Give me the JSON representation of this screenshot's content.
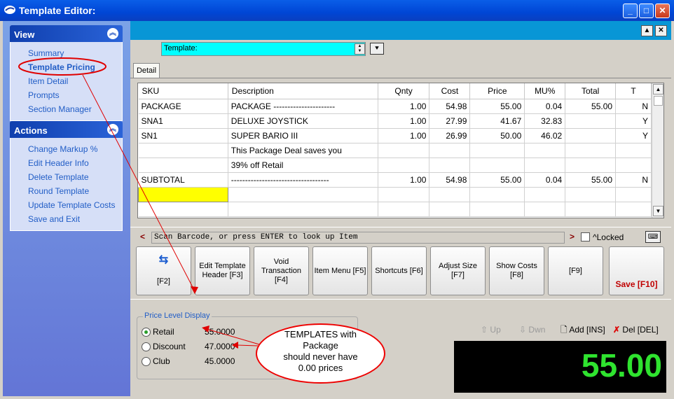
{
  "window": {
    "title": "Template Editor:"
  },
  "view_panel": {
    "title": "View",
    "items": [
      "Summary",
      "Template Pricing",
      "Item Detail",
      "Prompts",
      "Section Manager"
    ]
  },
  "actions_panel": {
    "title": "Actions",
    "items": [
      "Change Markup %",
      "Edit Header Info",
      "Delete Template",
      "Round Template",
      "Update Template Costs",
      "Save and Exit"
    ]
  },
  "template": {
    "label": "Template:"
  },
  "tab": {
    "detail": "Detail"
  },
  "grid": {
    "columns": [
      "SKU",
      "Description",
      "Qnty",
      "Cost",
      "Price",
      "MU%",
      "Total",
      "T"
    ],
    "rows": [
      [
        "PACKAGE",
        "PACKAGE ----------------------",
        "1.00",
        "54.98",
        "55.00",
        "0.04",
        "55.00",
        "N"
      ],
      [
        "SNA1",
        "DELUXE JOYSTICK",
        "1.00",
        "27.99",
        "41.67",
        "32.83",
        "",
        "Y"
      ],
      [
        "SN1",
        "SUPER BARIO III",
        "1.00",
        "26.99",
        "50.00",
        "46.02",
        "",
        "Y"
      ],
      [
        "",
        "This Package Deal saves you",
        "",
        "",
        "",
        "",
        "",
        ""
      ],
      [
        "",
        "39% off Retail",
        "",
        "",
        "",
        "",
        "",
        ""
      ],
      [
        "SUBTOTAL",
        "-----------------------------------",
        "1.00",
        "54.98",
        "55.00",
        "0.04",
        "55.00",
        "N"
      ],
      [
        "",
        "",
        "",
        "",
        "",
        "",
        "",
        ""
      ],
      [
        "",
        "",
        "",
        "",
        "",
        "",
        "",
        ""
      ]
    ]
  },
  "scan": {
    "prompt": "Scan Barcode, or press ENTER to look up Item",
    "left_arrow": "<",
    "right_arrow": ">",
    "locked_label": "^Locked"
  },
  "fkeys": {
    "f2": "[F2]",
    "f3": "Edit Template Header [F3]",
    "f4": "Void Transaction [F4]",
    "f5": "Item Menu [F5]",
    "f6": "Shortcuts [F6]",
    "f7": "Adjust Size [F7]",
    "f8": "Show Costs [F8]",
    "f9": "[F9]",
    "f10": "Save [F10]"
  },
  "price_level": {
    "legend": "Price Level Display",
    "levels": [
      {
        "name": "Retail",
        "value": "55.0000",
        "selected": true
      },
      {
        "name": "Discount",
        "value": "47.0000",
        "selected": false
      },
      {
        "name": "Club",
        "value": "45.0000",
        "selected": false
      }
    ]
  },
  "callout": {
    "line1": "TEMPLATES with",
    "line2": "Package",
    "line3": "should never have",
    "line4": "0.00 prices"
  },
  "toolbar": {
    "up": "Up",
    "down": "Dwn",
    "add": "Add [INS]",
    "del": "Del [DEL]"
  },
  "total_display": "55.00",
  "colors": {
    "title_blue": "#0046d5",
    "accent_cyan": "#00ffff",
    "display_green": "#2fe32f",
    "callout_red": "#e00000",
    "selected_row_yellow": "#ffff00"
  }
}
